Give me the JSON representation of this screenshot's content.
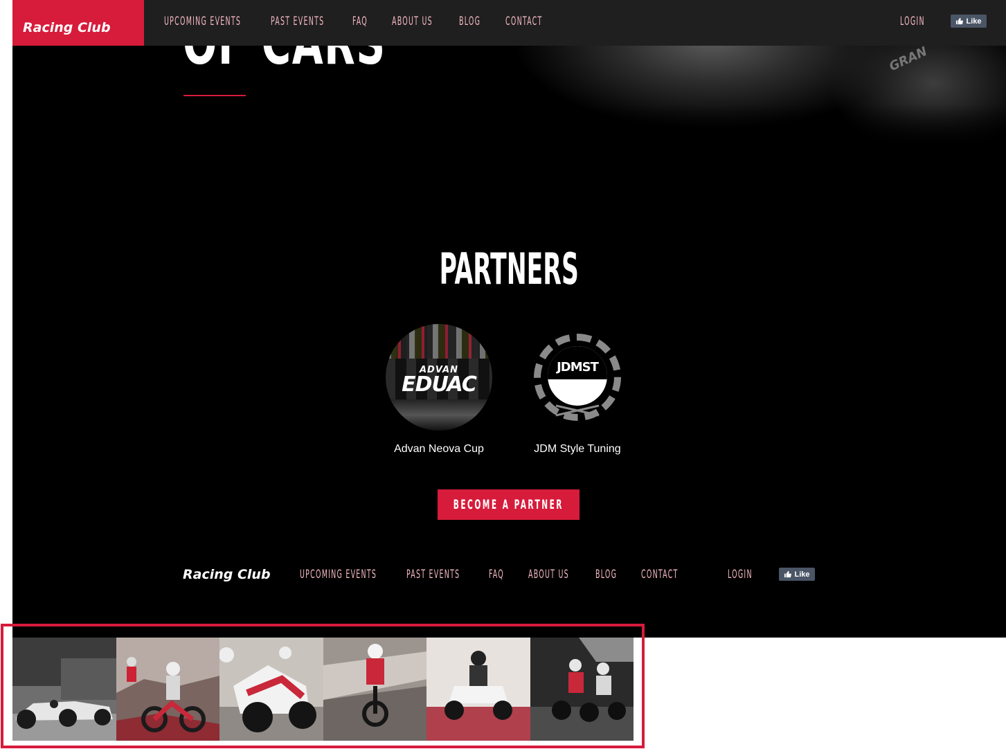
{
  "brand": {
    "name": "Racing Club"
  },
  "nav": {
    "links": [
      "UPCOMING EVENTS",
      "PAST EVENTS",
      "FAQ",
      "ABOUT US",
      "BLOG",
      "CONTACT"
    ],
    "login": "LOGIN",
    "like": "Like"
  },
  "hero": {
    "title": "OF CARS"
  },
  "partners": {
    "heading": "PARTNERS",
    "items": [
      {
        "name": "Advan Neova Cup",
        "logo_text_small": "ADVAN",
        "logo_text_big": "EDUAC"
      },
      {
        "name": "JDM Style Tuning",
        "logo_text": "JDMST"
      }
    ],
    "button": "BECOME A PARTNER"
  },
  "footer": {
    "brand": "Racing Club",
    "links": [
      "UPCOMING EVENTS",
      "PAST EVENTS",
      "FAQ",
      "ABOUT US",
      "BLOG",
      "CONTACT"
    ],
    "login": "LOGIN",
    "like": "Like"
  },
  "gallery": {
    "photos": [
      {
        "icon": "vintage-race-car-photo"
      },
      {
        "icon": "dirt-bike-photo"
      },
      {
        "icon": "sport-motorcycle-photo"
      },
      {
        "icon": "motocross-jump-photo"
      },
      {
        "icon": "atv-quad-photo"
      },
      {
        "icon": "atv-race-start-photo"
      }
    ]
  },
  "colors": {
    "accent": "#d71b3b",
    "nav_bg": "#1f1f1f",
    "page_bg": "#000000",
    "nav_text": "#f3b8c2"
  }
}
